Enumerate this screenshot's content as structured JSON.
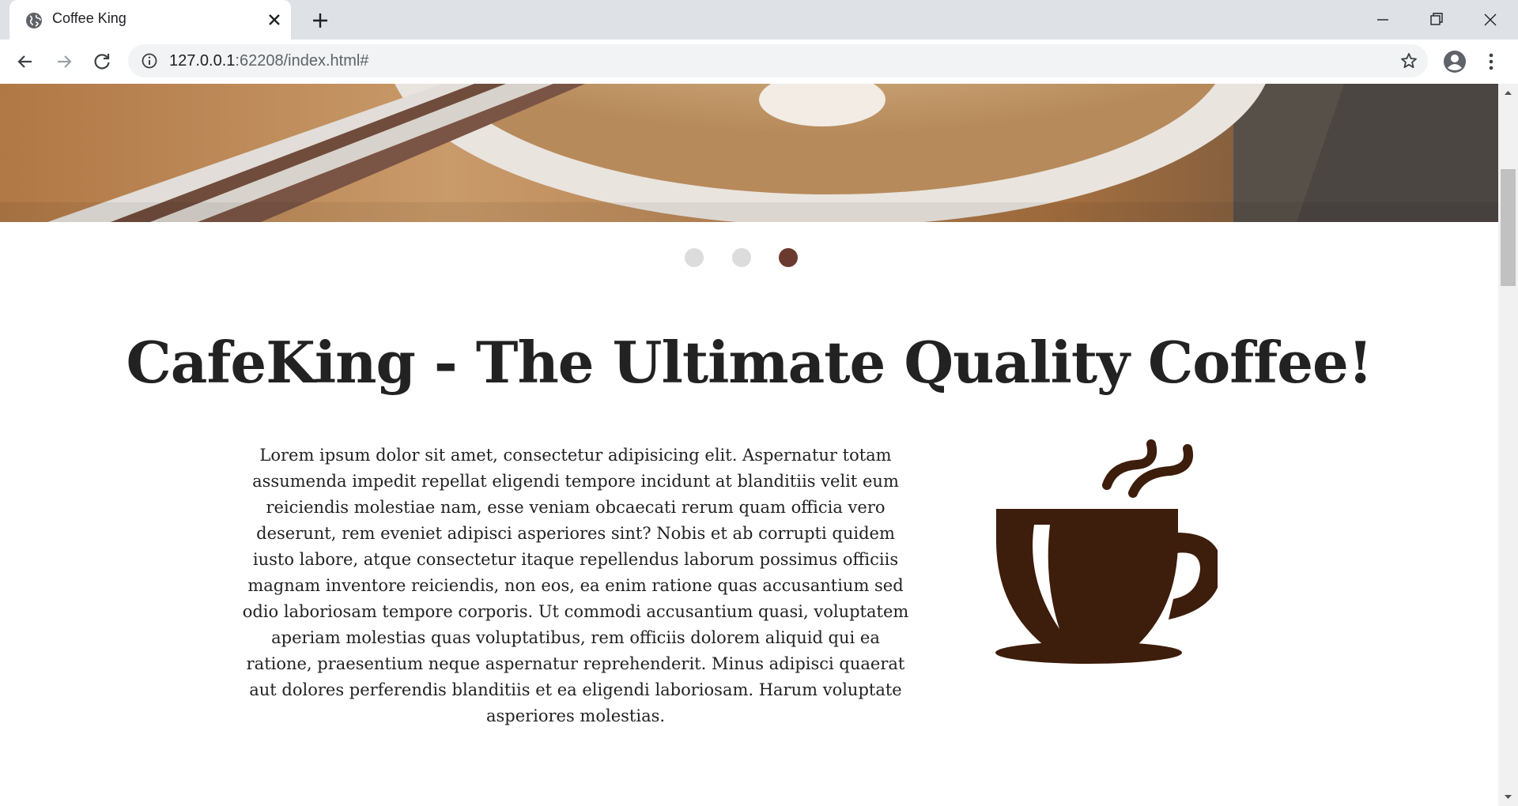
{
  "browser": {
    "tab_title": "Coffee King",
    "url_host": "127.0.0.1",
    "url_rest": ":62208/index.html#"
  },
  "carousel": {
    "slide_count": 3,
    "active_index": 2,
    "active_color": "#6b3a2e",
    "inactive_color": "#dcdcdc"
  },
  "main": {
    "headline": "CafeKing - The Ultimate Quality Coffee!",
    "body": "Lorem ipsum dolor sit amet, consectetur adipisicing elit. Aspernatur totam assumenda impedit repellat eligendi tempore incidunt at blanditiis velit eum reiciendis molestiae nam, esse veniam obcaecati rerum quam officia vero deserunt, rem eveniet adipisci asperiores sint? Nobis et ab corrupti quidem iusto labore, atque consectetur itaque repellendus laborum possimus officiis magnam inventore reiciendis, non eos, ea enim ratione quas accusantium sed odio laboriosam tempore corporis. Ut commodi accusantium quasi, voluptatem aperiam molestias quas voluptatibus, rem officiis dolorem aliquid qui ea ratione, praesentium neque aspernatur reprehenderit. Minus adipisci quaerat aut dolores perferendis blanditiis et ea eligendi laboriosam. Harum voluptate asperiores molestias."
  },
  "icons": {
    "favicon": "globe-icon",
    "cup": "coffee-cup-icon",
    "cup_color": "#3d1d0b"
  }
}
